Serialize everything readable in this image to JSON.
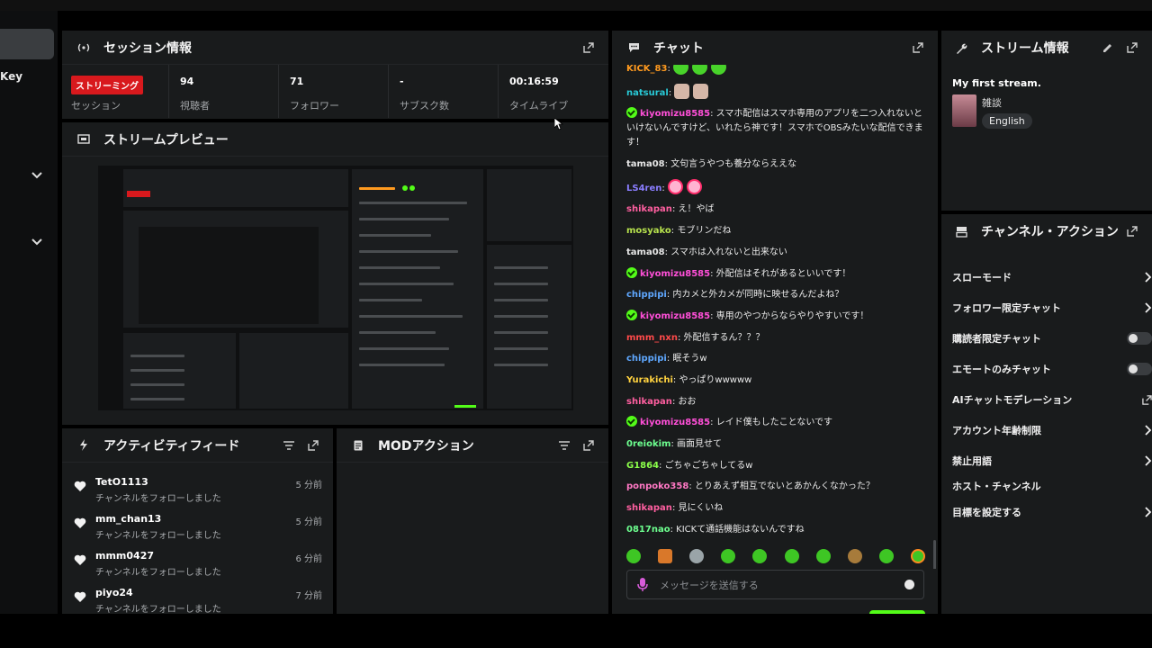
{
  "sidebar": {
    "key_label": "Key"
  },
  "session": {
    "title": "セッション情報",
    "status_badge": "ストリーミング",
    "status_label": "セッション",
    "viewers": {
      "value": "94",
      "label": "視聴者"
    },
    "followers": {
      "value": "71",
      "label": "フォロワー"
    },
    "subs": {
      "value": "-",
      "label": "サブスク数"
    },
    "uptime": {
      "value": "00:16:59",
      "label": "タイムライブ"
    }
  },
  "preview": {
    "title": "ストリームプレビュー"
  },
  "activity": {
    "title": "アクティビティフィード",
    "items": [
      {
        "name": "TetO1113",
        "text": "チャンネルをフォローしました",
        "time": "5 分前"
      },
      {
        "name": "mm_chan13",
        "text": "チャンネルをフォローしました",
        "time": "5 分前"
      },
      {
        "name": "mmm0427",
        "text": "チャンネルをフォローしました",
        "time": "6 分前"
      },
      {
        "name": "piyo24",
        "text": "チャンネルをフォローしました",
        "time": "7 分前"
      }
    ]
  },
  "mod": {
    "title": "MODアクション"
  },
  "chat": {
    "title": "チャット",
    "messages": [
      {
        "user": "KICK_83",
        "color": "#ff9a1f",
        "text": "",
        "emotes": 3,
        "emote_style": "green",
        "verified": false
      },
      {
        "user": "natsural",
        "color": "#28c9d6",
        "text": "",
        "emotes": 2,
        "emote_style": "skin",
        "verified": false
      },
      {
        "user": "kiyomizu8585",
        "color": "#ff4fd8",
        "text": "スマホ配信はスマホ専用のアプリを二つ入れないといけないんですけど、いれたら神です！スマホでOBSみたいな配信できます！",
        "verified": true
      },
      {
        "user": "tama08",
        "color": "#e5e5e5",
        "text": "文句言うやつも養分ならええな",
        "verified": false
      },
      {
        "user": "LS4ren",
        "color": "#8a7dff",
        "text": "",
        "emotes": 2,
        "emote_style": "pink",
        "verified": false
      },
      {
        "user": "shikapan",
        "color": "#ff5fa0",
        "text": "え！やば",
        "verified": false
      },
      {
        "user": "mosyako",
        "color": "#b7e24d",
        "text": "モブリンだね",
        "verified": false
      },
      {
        "user": "tama08",
        "color": "#e5e5e5",
        "text": "スマホは入れないと出来ない",
        "verified": false
      },
      {
        "user": "kiyomizu8585",
        "color": "#ff4fd8",
        "text": "外配信はそれがあるといいです！",
        "verified": true
      },
      {
        "user": "chippipi",
        "color": "#5fa8ff",
        "text": "内カメと外カメが同時に映せるんだよね？",
        "verified": false
      },
      {
        "user": "kiyomizu8585",
        "color": "#ff4fd8",
        "text": "専用のやつからならやりやすいです！",
        "verified": true
      },
      {
        "user": "mmm_nxn",
        "color": "#ff4a4a",
        "text": "外配信するん？？？",
        "verified": false
      },
      {
        "user": "chippipi",
        "color": "#5fa8ff",
        "text": "眠そうw",
        "verified": false
      },
      {
        "user": "Yurakichi",
        "color": "#ffd23f",
        "text": "やっぱりwwwww",
        "verified": false
      },
      {
        "user": "shikapan",
        "color": "#ff5fa0",
        "text": "おお",
        "verified": false
      },
      {
        "user": "kiyomizu8585",
        "color": "#ff4fd8",
        "text": "レイド僕もしたことないです",
        "verified": true
      },
      {
        "user": "0reiokim",
        "color": "#6dff8f",
        "text": "画面見せて",
        "verified": false
      },
      {
        "user": "G1864",
        "color": "#8bff4a",
        "text": "ごちゃごちゃしてるw",
        "verified": false
      },
      {
        "user": "ponpoko358",
        "color": "#ff78c4",
        "text": "とりあえず相互でないとあかんくなかった？",
        "verified": false
      },
      {
        "user": "shikapan",
        "color": "#ff5fa0",
        "text": "見にくいね",
        "verified": false
      },
      {
        "user": "0817nao",
        "color": "#6dff8f",
        "text": "KICKて通話機能はないんですね",
        "verified": false
      }
    ],
    "input_placeholder": "メッセージを送信する"
  },
  "stream_info": {
    "title": "ストリーム情報",
    "stream_title": "My first stream.",
    "category": "雑談",
    "tag": "English"
  },
  "channel_actions": {
    "title": "チャンネル・アクション",
    "items": [
      {
        "label": "スローモード",
        "control": "chevron"
      },
      {
        "label": "フォロワー限定チャット",
        "control": "chevron"
      },
      {
        "label": "購読者限定チャット",
        "control": "toggle"
      },
      {
        "label": "エモートのみチャット",
        "control": "toggle"
      },
      {
        "label": "AIチャットモデレーション",
        "control": "external"
      },
      {
        "label": "アカウント年齢制限",
        "control": "chevron"
      },
      {
        "label": "禁止用語",
        "control": "chevron"
      },
      {
        "label": "ホスト・チャンネル",
        "control": "none"
      },
      {
        "label": "目標を設定する",
        "control": "chevron"
      }
    ]
  },
  "colors": {
    "accent": "#53fc18",
    "live": "#d8191d",
    "panel": "#191b1c"
  }
}
